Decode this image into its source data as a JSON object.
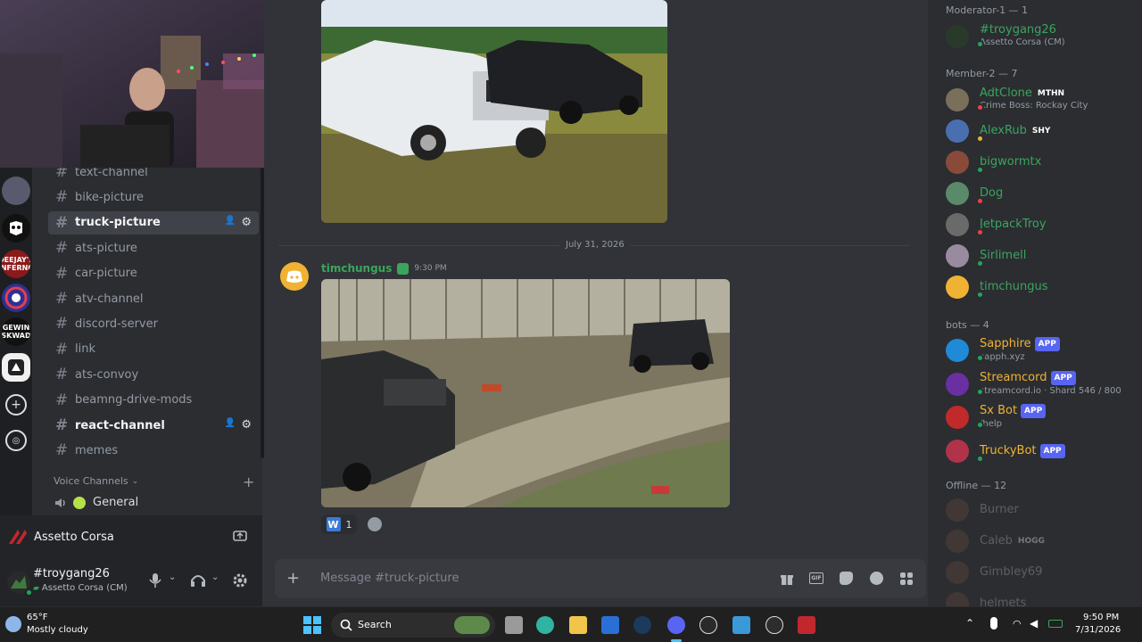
{
  "webcam": {
    "label": "webcam-feed"
  },
  "servers": [
    {
      "name": "server-1",
      "abbr": "",
      "color": "#5a5a6e"
    },
    {
      "name": "server-2",
      "abbr": "",
      "color": "#111111"
    },
    {
      "name": "server-deejays-inferno",
      "abbr": "DEEJAY'S INFERNO",
      "color": "#8b1a1a"
    },
    {
      "name": "server-4",
      "abbr": "",
      "color": "#303090"
    },
    {
      "name": "server-gewin-skwad",
      "abbr": "GEWIN SKWAD",
      "color": "#111111"
    },
    {
      "name": "server-6",
      "abbr": "",
      "color": "#f0f0f0"
    }
  ],
  "channels": {
    "text": [
      {
        "name": "text-channel",
        "state": "normal"
      },
      {
        "name": "bike-picture",
        "state": "normal"
      },
      {
        "name": "truck-picture",
        "state": "active"
      },
      {
        "name": "ats-picture",
        "state": "normal"
      },
      {
        "name": "car-picture",
        "state": "normal"
      },
      {
        "name": "atv-channel",
        "state": "normal"
      },
      {
        "name": "discord-server",
        "state": "normal"
      },
      {
        "name": "link",
        "state": "normal"
      },
      {
        "name": "ats-convoy",
        "state": "normal"
      },
      {
        "name": "beamng-drive-mods",
        "state": "normal"
      },
      {
        "name": "react-channel",
        "state": "bright"
      },
      {
        "name": "memes",
        "state": "normal"
      }
    ],
    "voice_heading": "Voice Channels",
    "voice": [
      {
        "name": "General"
      }
    ]
  },
  "activity": {
    "game": "Assetto Corsa"
  },
  "user_panel": {
    "username": "#troygang26",
    "status": "Assetto Corsa (CM)"
  },
  "chat": {
    "date_divider": "July 31, 2026",
    "message": {
      "author": "timchungus",
      "time": "9:30 PM"
    },
    "reaction": {
      "emoji": "W",
      "count": "1"
    },
    "composer_placeholder": "Message #truck-picture"
  },
  "members": {
    "groups": [
      {
        "title": "Moderator-1 — 1"
      },
      {
        "title": "Member-2 — 7"
      },
      {
        "title": "bots — 4"
      },
      {
        "title": "Offline — 12"
      }
    ],
    "moderators": [
      {
        "name": "#troygang26",
        "sub": "Assetto Corsa (CM)",
        "color": "#3ba55d",
        "status": "online"
      }
    ],
    "member2": [
      {
        "name": "AdtClone",
        "badge": "MTHN",
        "sub": "Crime Boss: Rockay City",
        "color": "#3ba55d",
        "status": "dnd"
      },
      {
        "name": "AlexRub",
        "badge": "SHY",
        "sub": "",
        "color": "#3ba55d",
        "status": "idle"
      },
      {
        "name": "bigwormtx",
        "badge": "",
        "sub": "",
        "color": "#3ba55d",
        "status": "online"
      },
      {
        "name": "Dog",
        "badge": "",
        "sub": "",
        "color": "#3ba55d",
        "status": "dnd"
      },
      {
        "name": "JetpackTroy",
        "badge": "",
        "sub": "",
        "color": "#3ba55d",
        "status": "dnd"
      },
      {
        "name": "Sirlimell",
        "badge": "",
        "sub": "",
        "color": "#3ba55d",
        "status": "mobile"
      },
      {
        "name": "timchungus",
        "badge": "",
        "sub": "",
        "color": "#3ba55d",
        "status": "online"
      }
    ],
    "bots": [
      {
        "name": "Sapphire",
        "badge": "APP",
        "sub": "sapph.xyz",
        "color": "#f0b232",
        "status": "online"
      },
      {
        "name": "Streamcord",
        "badge": "APP",
        "sub": "streamcord.io · Shard 546 / 800",
        "color": "#f0b232",
        "status": "online"
      },
      {
        "name": "Sx Bot",
        "badge": "APP",
        "sub": "/help",
        "color": "#f0b232",
        "status": "online"
      },
      {
        "name": "TruckyBot",
        "badge": "APP",
        "sub": "",
        "color": "#f0b232",
        "status": "online"
      }
    ],
    "offline": [
      {
        "name": "Burner",
        "badge": ""
      },
      {
        "name": "Caleb",
        "badge": "HOGG"
      },
      {
        "name": "Gimbley69",
        "badge": ""
      },
      {
        "name": "helmets",
        "badge": ""
      }
    ]
  },
  "taskbar": {
    "weather_temp": "65°F",
    "weather_desc": "Mostly cloudy",
    "search_label": "Search",
    "time": "9:50 PM",
    "date": "7/31/2026"
  }
}
